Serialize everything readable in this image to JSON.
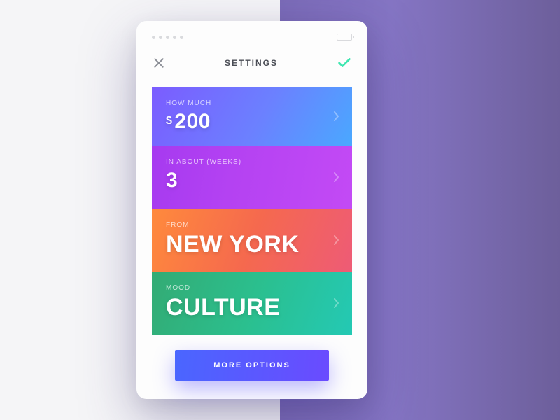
{
  "header": {
    "title": "SETTINGS"
  },
  "cards": {
    "how_much": {
      "label": "HOW MUCH",
      "currency": "$",
      "value": "200"
    },
    "in_about": {
      "label": "IN ABOUT (WEEKS)",
      "value": "3"
    },
    "from": {
      "label": "FROM",
      "value": "NEW YORK"
    },
    "mood": {
      "label": "MOOD",
      "value": "CULTURE"
    }
  },
  "footer": {
    "more_options": "MORE OPTIONS"
  }
}
